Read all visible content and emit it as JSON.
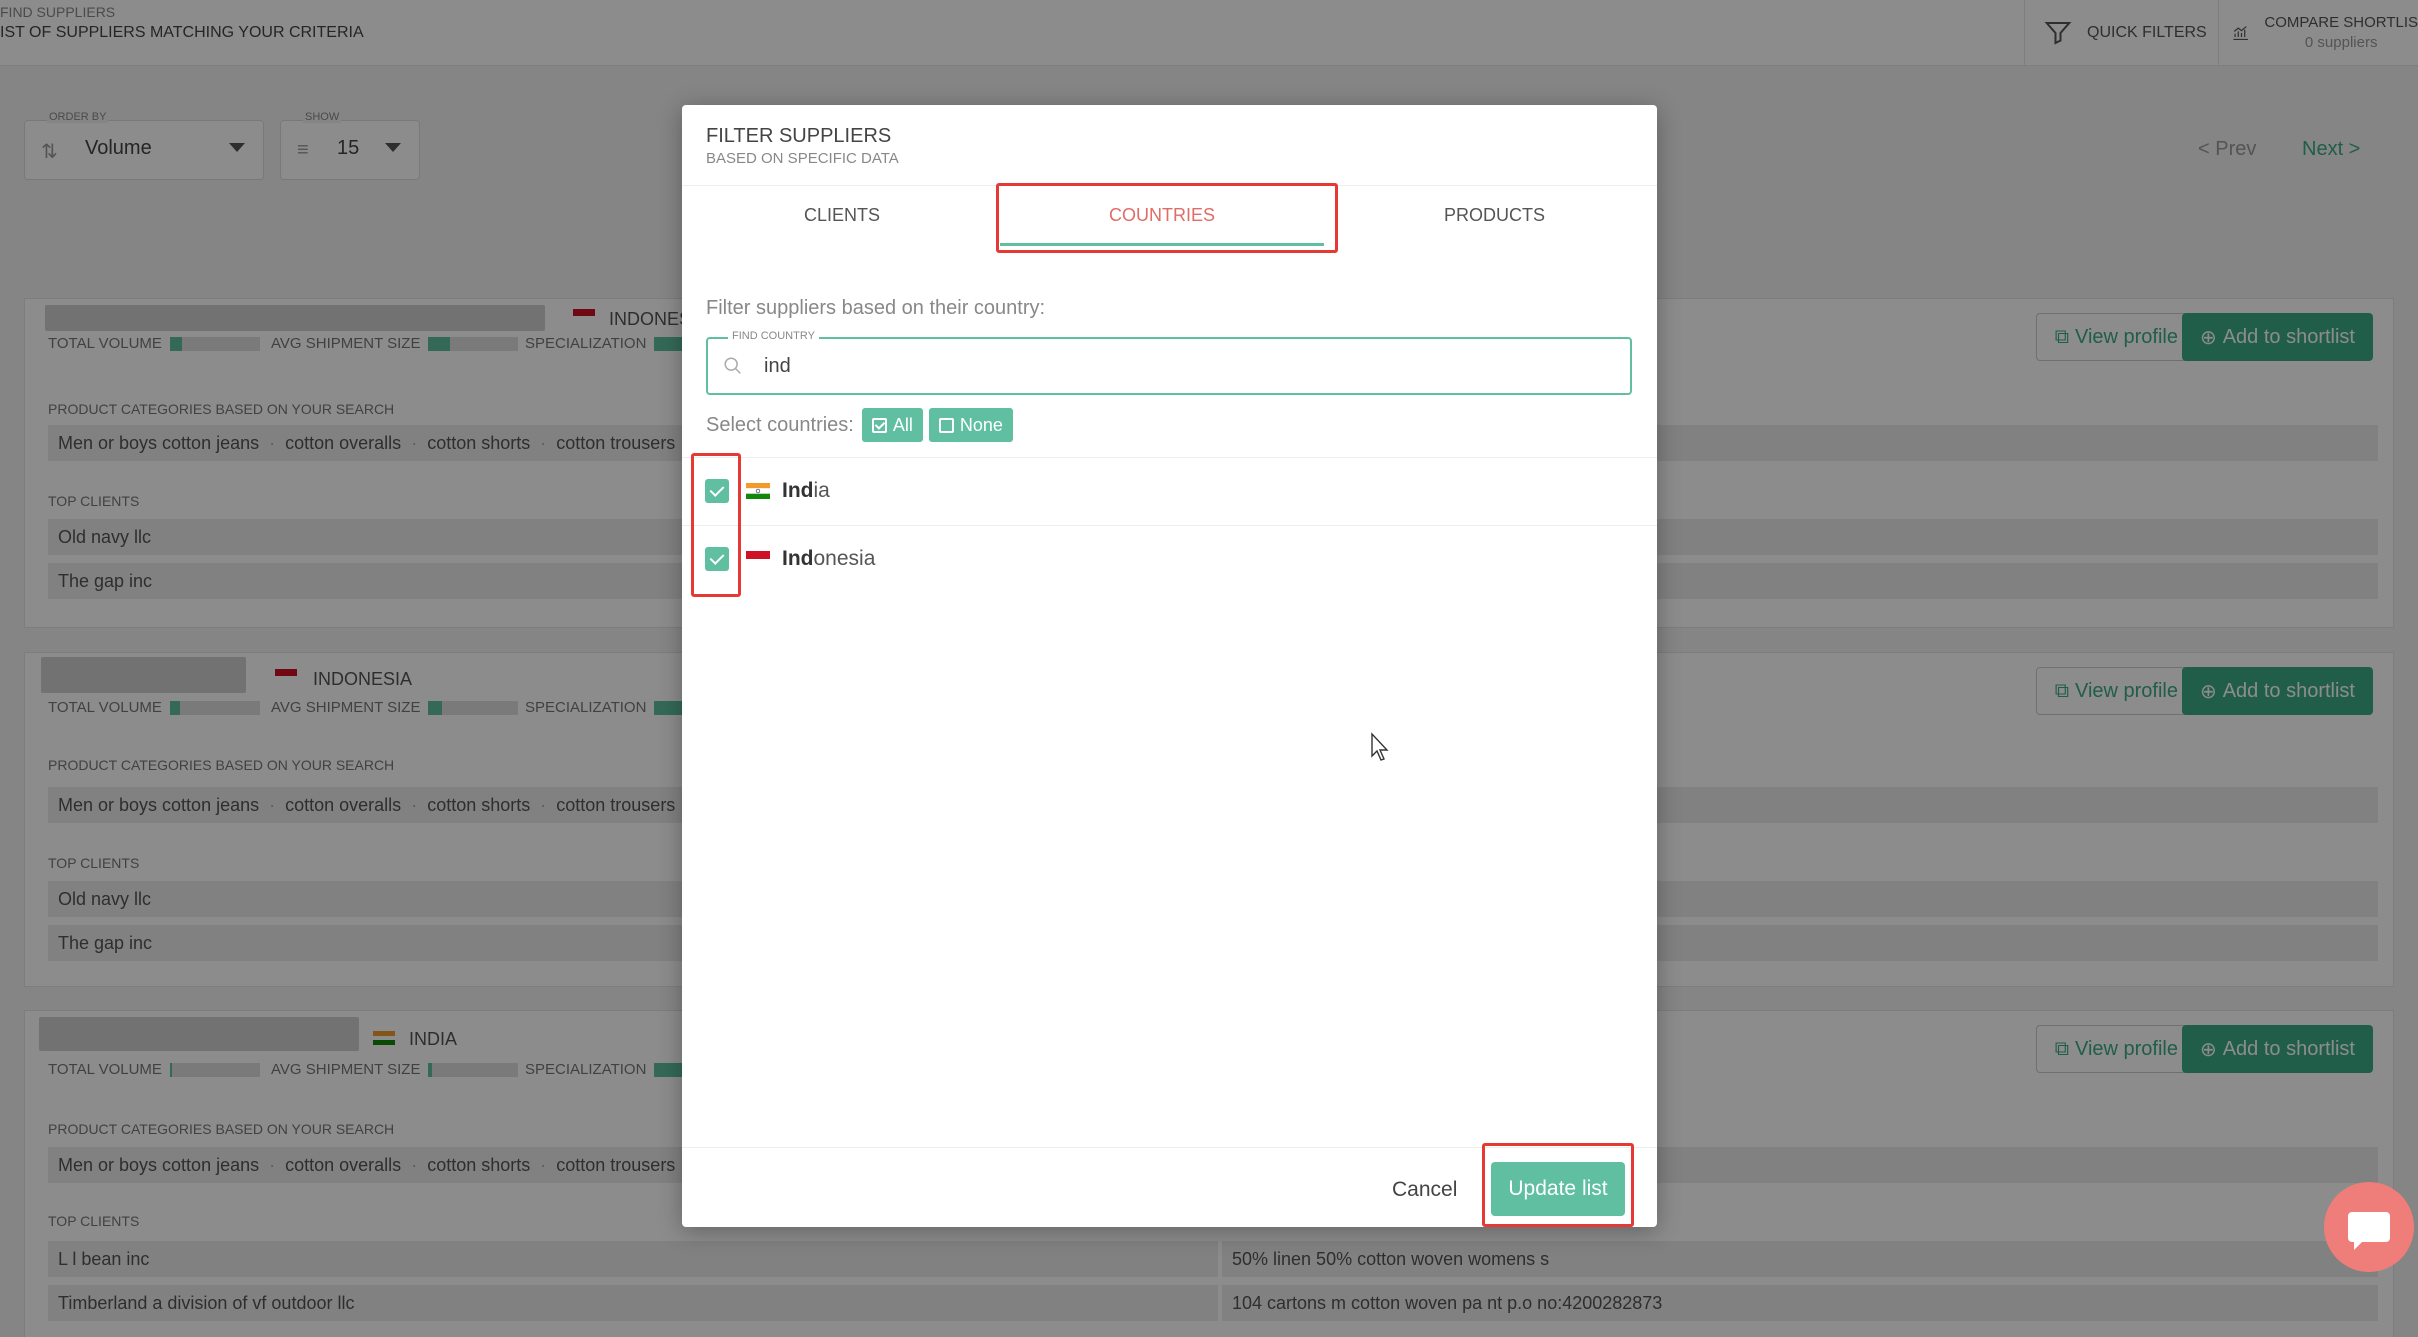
{
  "header": {
    "crumb_top": "FIND SUPPLIERS",
    "crumb_bottom": "IST OF SUPPLIERS MATCHING YOUR CRITERIA",
    "quick_filters": "QUICK FILTERS",
    "compare_label": "COMPARE SHORTLIS",
    "compare_count": "0 suppliers"
  },
  "controls": {
    "order_by_label": "ORDER BY",
    "order_by_value": "Volume",
    "show_label": "SHOW",
    "show_value": "15",
    "prev": "< Prev",
    "next": "Next >"
  },
  "cards": [
    {
      "country": "INDONES",
      "metrics": {
        "total_volume": "TOTAL VOLUME",
        "avg_shipment": "AVG SHIPMENT SIZE",
        "specialization": "SPECIALIZATION"
      },
      "categories_title": "PRODUCT CATEGORIES BASED ON YOUR SEARCH",
      "categories": [
        "Men or boys cotton jeans",
        "cotton overalls",
        "cotton shorts",
        "cotton trousers"
      ],
      "clients_title": "TOP CLIENTS",
      "clients": [
        "Old navy llc",
        "The gap inc"
      ],
      "view_profile": "View profile",
      "add_shortlist": "Add to shortlist"
    },
    {
      "country": "INDONESIA",
      "metrics": {
        "total_volume": "TOTAL VOLUME",
        "avg_shipment": "AVG SHIPMENT SIZE",
        "specialization": "SPECIALIZATION"
      },
      "categories_title": "PRODUCT CATEGORIES BASED ON YOUR SEARCH",
      "categories": [
        "Men or boys cotton jeans",
        "cotton overalls",
        "cotton shorts",
        "cotton trousers"
      ],
      "clients_title": "TOP CLIENTS",
      "clients": [
        "Old navy llc",
        "The gap inc"
      ],
      "view_profile": "View profile",
      "add_shortlist": "Add to shortlist"
    },
    {
      "country": "INDIA",
      "metrics": {
        "total_volume": "TOTAL VOLUME",
        "avg_shipment": "AVG SHIPMENT SIZE",
        "specialization": "SPECIALIZATION"
      },
      "categories_title": "PRODUCT CATEGORIES BASED ON YOUR SEARCH",
      "categories": [
        "Men or boys cotton jeans",
        "cotton overalls",
        "cotton shorts",
        "cotton trousers"
      ],
      "clients_title": "TOP CLIENTS",
      "clients": [
        "L l bean inc",
        "Timberland a division of vf outdoor llc"
      ],
      "client_products": [
        "50% linen 50% cotton woven womens s",
        "104 cartons m cotton woven pa nt p.o no:4200282873"
      ],
      "view_profile": "View profile",
      "add_shortlist": "Add to shortlist"
    }
  ],
  "modal": {
    "title": "FILTER SUPPLIERS",
    "subtitle": "BASED ON SPECIFIC DATA",
    "tabs": [
      {
        "label": "CLIENTS",
        "active": false
      },
      {
        "label": "COUNTRIES",
        "active": true
      },
      {
        "label": "PRODUCTS",
        "active": false
      }
    ],
    "filter_label": "Filter suppliers based on their country:",
    "search": {
      "label": "FIND COUNTRY",
      "value": "ind"
    },
    "select_label": "Select countries:",
    "select_all": "All",
    "select_none": "None",
    "countries": [
      {
        "match": "Ind",
        "rest": "ia",
        "checked": true
      },
      {
        "match": "Ind",
        "rest": "onesia",
        "checked": true
      }
    ],
    "cancel": "Cancel",
    "update": "Update list"
  },
  "colors": {
    "accent": "#5fbfa0",
    "active_tab": "#e06c67",
    "highlight": "#e53935",
    "chat": "#ef7e7a"
  },
  "icons": [
    "sort-icon",
    "list-icon",
    "filter-icon",
    "chart-icon",
    "external-link-icon",
    "plus-circle-icon",
    "search-icon",
    "check-icon",
    "chat-icon",
    "cursor-icon"
  ]
}
